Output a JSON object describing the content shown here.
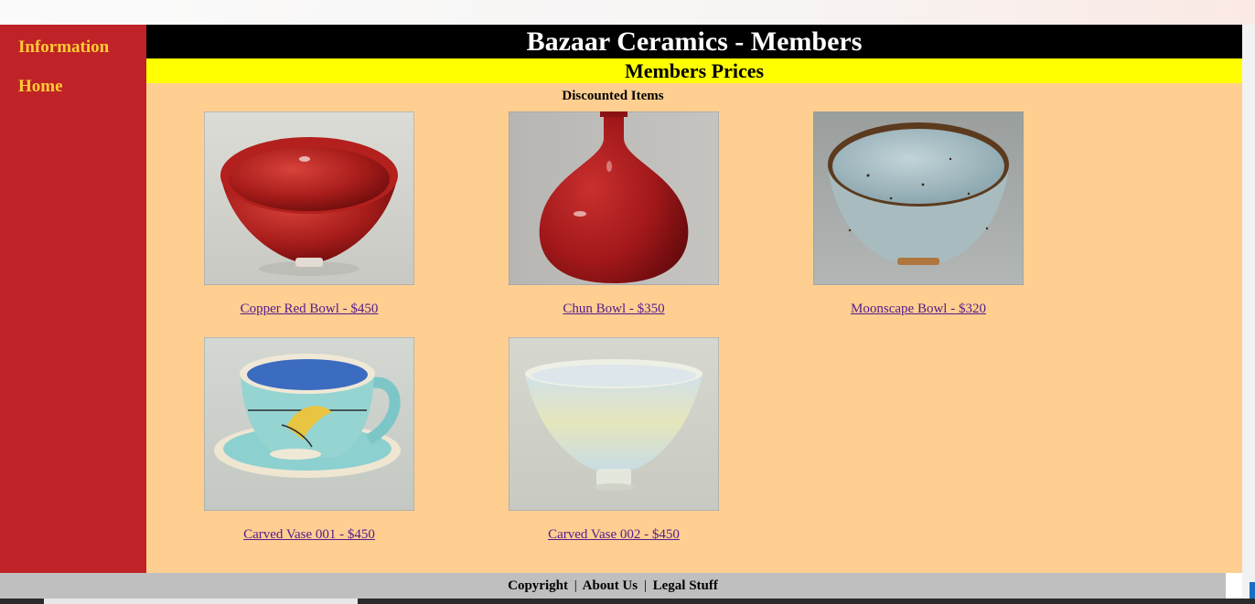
{
  "site": {
    "title": "Bazaar Ceramics - Members",
    "section_title": "Members Prices",
    "subheading": "Discounted Items"
  },
  "sidebar": {
    "items": [
      {
        "label": "Information"
      },
      {
        "label": "Home"
      }
    ]
  },
  "products": [
    {
      "caption": "Copper Red Bowl - $450",
      "image": "copper-red-bowl"
    },
    {
      "caption": "Chun Bowl - $350",
      "image": "chun-bowl-vase"
    },
    {
      "caption": "Moonscape Bowl - $320",
      "image": "moonscape-bowl"
    },
    {
      "caption": "Carved Vase 001 - $450",
      "image": "cup-and-saucer"
    },
    {
      "caption": "Carved Vase 002 - $450",
      "image": "pale-bowl"
    }
  ],
  "footer": {
    "copyright": "Copyright",
    "about": "About Us",
    "legal": "Legal Stuff",
    "separator": "|"
  },
  "colors": {
    "sidebar": "#bf2227",
    "nav_text": "#ffcc33",
    "content_bg": "#ffcf91",
    "header_bg": "#000000",
    "section_bg": "#ffff00",
    "footer_bg": "#bfbfbf",
    "link": "#551a8b"
  }
}
